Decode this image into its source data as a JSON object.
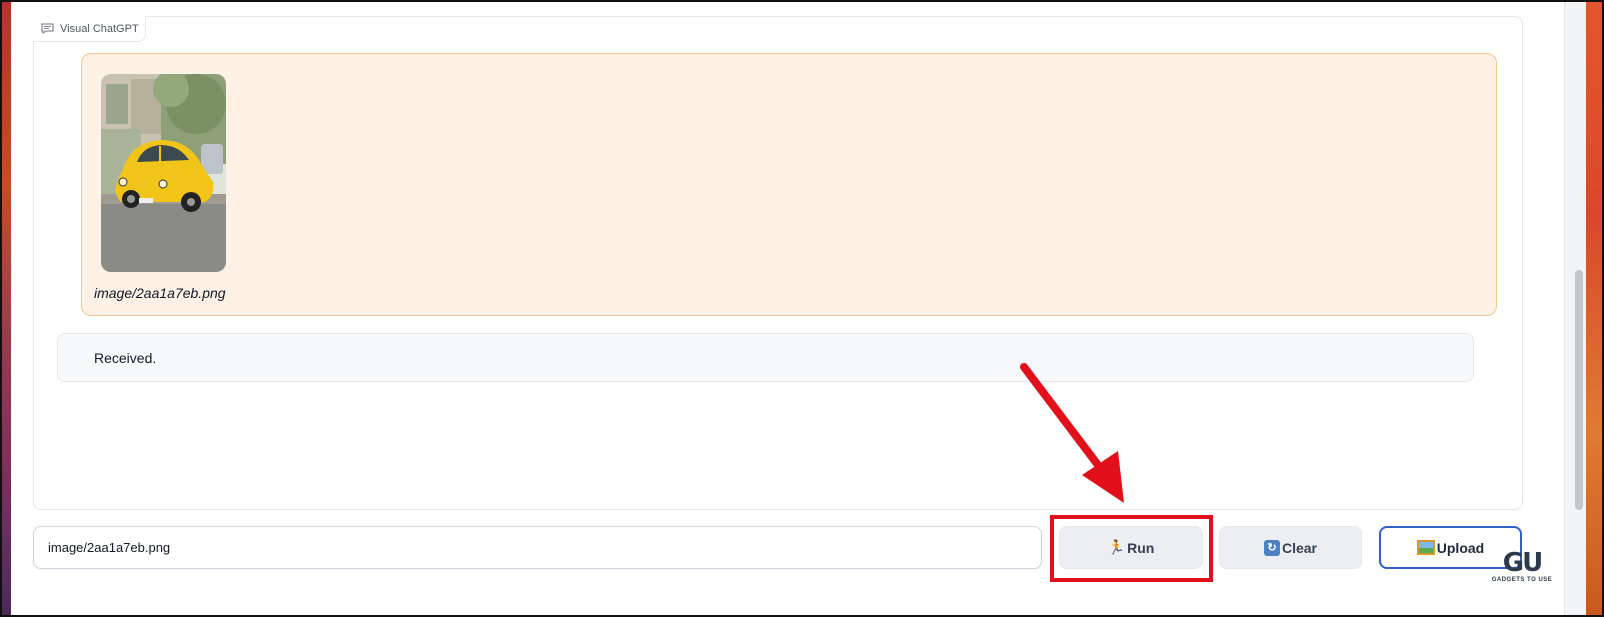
{
  "panel": {
    "label": "Visual ChatGPT",
    "icon": "chat-bubble-icon"
  },
  "messages": {
    "user": {
      "image_alt": "yellow car",
      "caption": "image/2aa1a7eb.png"
    },
    "bot": {
      "text": "Received."
    }
  },
  "input": {
    "value": "image/2aa1a7eb.png",
    "placeholder": ""
  },
  "buttons": {
    "run": {
      "label": "Run",
      "icon": "runner-icon"
    },
    "clear": {
      "label": "Clear",
      "icon": "refresh-icon"
    },
    "upload": {
      "label": "Upload",
      "icon": "picture-icon"
    }
  },
  "watermark": {
    "logo": "GU",
    "tagline": "GADGETS TO USE"
  },
  "colors": {
    "user_bubble_bg": "#fdf1e6",
    "user_bubble_border": "#f5c68f",
    "highlight": "#e2101a",
    "upload_border": "#2f5fc9"
  }
}
